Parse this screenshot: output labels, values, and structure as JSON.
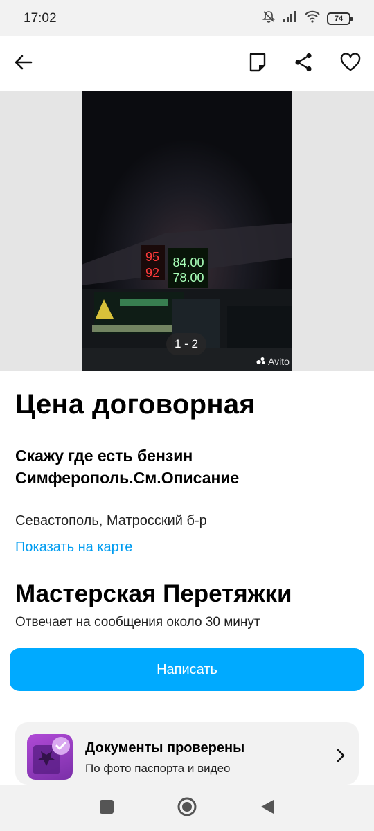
{
  "status_bar": {
    "time": "17:02",
    "battery": "74",
    "icons": [
      "mute-icon",
      "signal-icon",
      "wifi-icon",
      "battery-icon"
    ]
  },
  "toolbar": {
    "icons": [
      "back-arrow-icon",
      "note-icon",
      "share-icon",
      "heart-icon"
    ]
  },
  "gallery": {
    "counter": "1 - 2",
    "watermark": "Avito",
    "sign_values": [
      "95",
      "92",
      "84.00",
      "78.00"
    ]
  },
  "listing": {
    "price": "Цена договорная",
    "title": "Скажу где есть бензин Симферополь.См.Описание",
    "address": "Севастополь, Матросский б-р",
    "map_link": "Показать на карте"
  },
  "seller": {
    "name": "Мастерская Перетяжки",
    "reply_time": "Отвечает на сообщения около 30 минут"
  },
  "actions": {
    "write_label": "Написать"
  },
  "docs": {
    "title": "Документы проверены",
    "subtitle": "По фото паспорта и видео"
  },
  "colors": {
    "accent": "#00aaff",
    "link": "#009cf0",
    "badge_purple": "#9b3fc6"
  },
  "navbar": {
    "icons": [
      "recents-square-icon",
      "home-circle-icon",
      "back-triangle-icon"
    ]
  }
}
